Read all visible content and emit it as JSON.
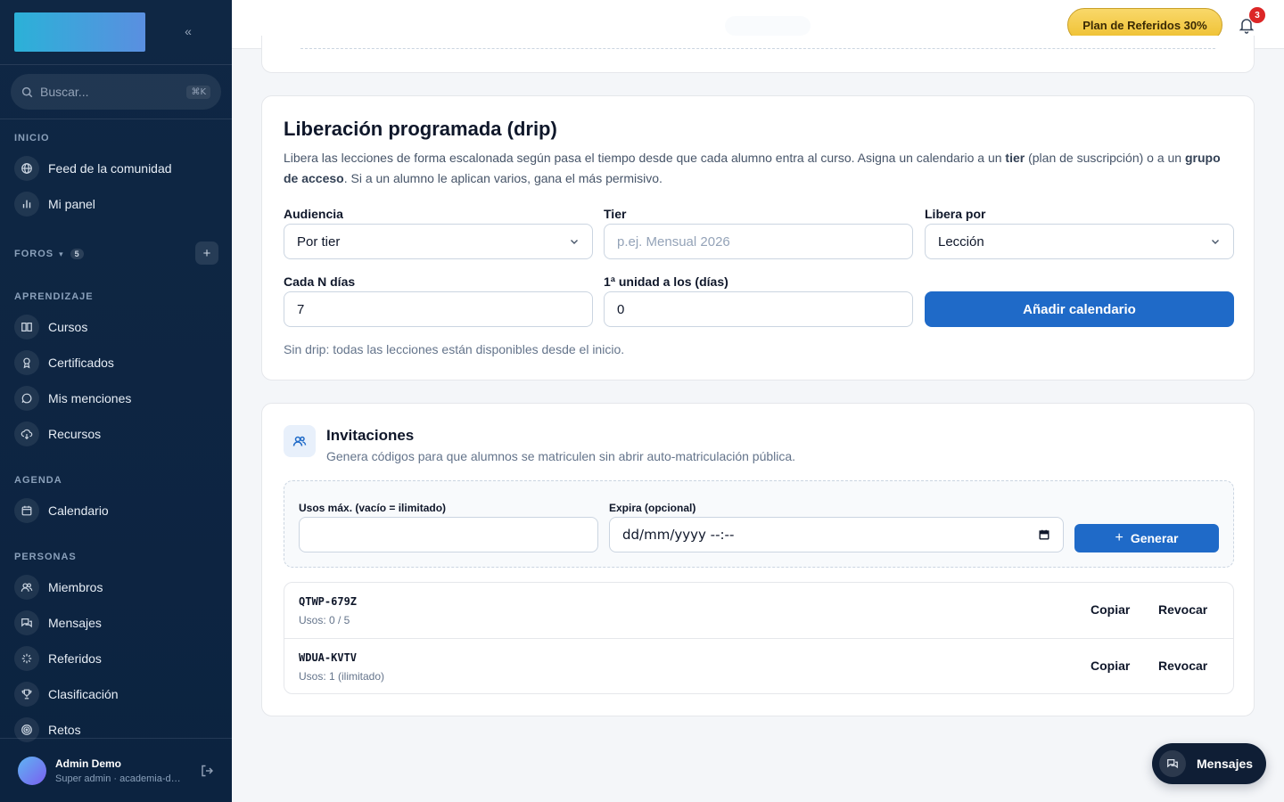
{
  "sidebar": {
    "search_placeholder": "Buscar...",
    "search_shortcut": "⌘K",
    "sections": {
      "inicio": "INICIO",
      "foros": "FOROS",
      "foros_count": "5",
      "aprendizaje": "APRENDIZAJE",
      "agenda": "AGENDA",
      "personas": "PERSONAS"
    },
    "items": {
      "feed": "Feed de la comunidad",
      "panel": "Mi panel",
      "cursos": "Cursos",
      "certificados": "Certificados",
      "menciones": "Mis menciones",
      "recursos": "Recursos",
      "calendario": "Calendario",
      "miembros": "Miembros",
      "mensajes": "Mensajes",
      "referidos": "Referidos",
      "clasificacion": "Clasificación",
      "retos": "Retos"
    },
    "user": {
      "name": "Admin Demo",
      "subtitle": "Super admin · academia-demo"
    }
  },
  "topbar": {
    "referral_button": "Plan de Referidos 30%",
    "notification_count": "3"
  },
  "drip": {
    "title": "Liberación programada (drip)",
    "desc_1": "Libera las lecciones de forma escalonada según pasa el tiempo desde que cada alumno entra al curso. Asigna un calendario a un ",
    "desc_tier": "tier",
    "desc_2": " (plan de suscripción) o a un ",
    "desc_group": "grupo de acceso",
    "desc_3": ". Si a un alumno le aplican varios, gana el más permisivo.",
    "audiencia_label": "Audiencia",
    "audiencia_value": "Por tier",
    "tier_label": "Tier",
    "tier_placeholder": "p.ej. Mensual 2026",
    "libera_label": "Libera por",
    "libera_value": "Lección",
    "cada_label": "Cada N días",
    "cada_value": "7",
    "primera_label": "1ª unidad a los (días)",
    "primera_value": "0",
    "add_button": "Añadir calendario",
    "note": "Sin drip: todas las lecciones están disponibles desde el inicio."
  },
  "invitations": {
    "title": "Invitaciones",
    "subtitle": "Genera códigos para que alumnos se matriculen sin abrir auto-matriculación pública.",
    "max_uses_label": "Usos máx. (vacío = ilimitado)",
    "max_uses_value": "",
    "expires_label": "Expira (opcional)",
    "expires_value": "dd/mm/yyyy --:--",
    "generate_button": "Generar",
    "copy_label": "Copiar",
    "revoke_label": "Revocar",
    "codes": [
      {
        "code": "QTWP-679Z",
        "uses": "Usos: 0 / 5"
      },
      {
        "code": "WDUA-KVTV",
        "uses": "Usos: 1 (ilimitado)"
      }
    ]
  },
  "floating": {
    "messages_button": "Mensajes"
  }
}
